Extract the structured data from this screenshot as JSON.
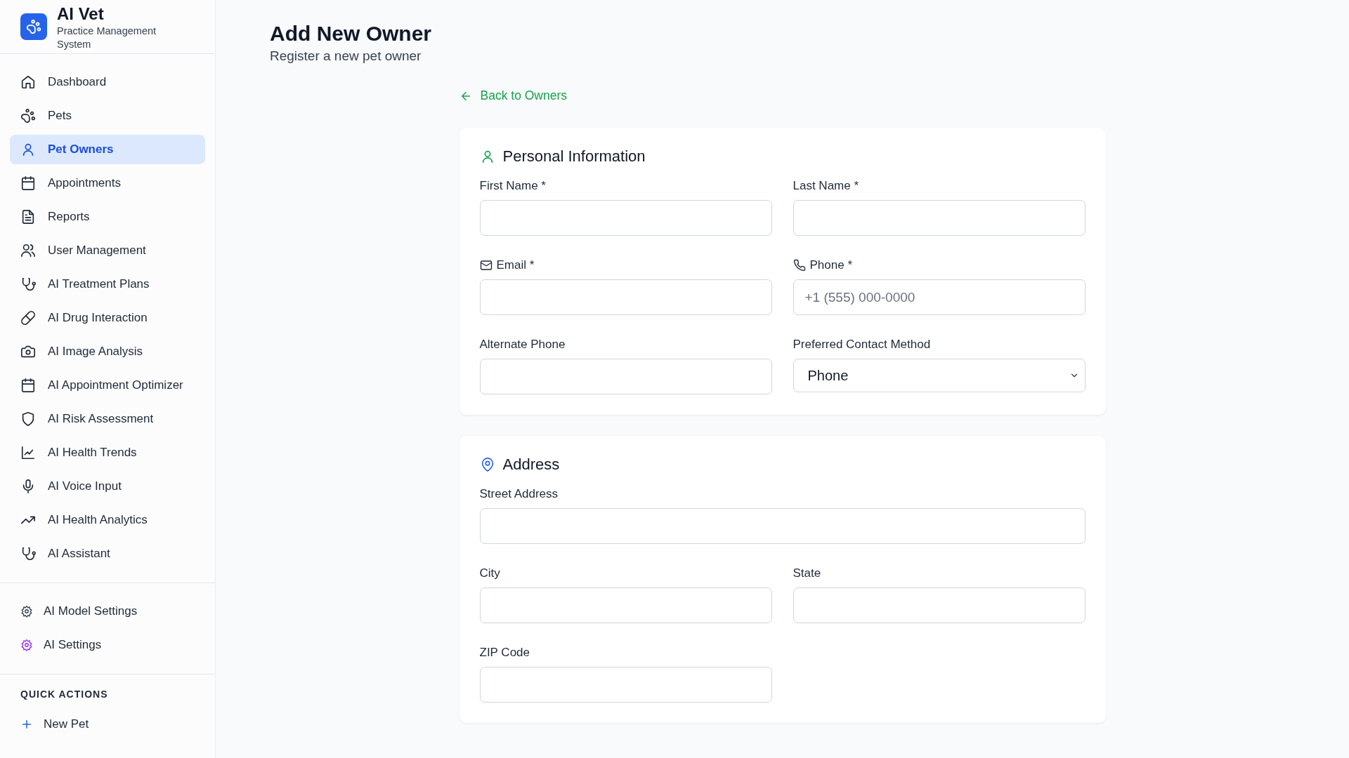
{
  "app": {
    "name": "AI Vet",
    "subtitle": "Practice Management System"
  },
  "nav": [
    {
      "label": "Dashboard",
      "selected": false
    },
    {
      "label": "Pets",
      "selected": false
    },
    {
      "label": "Pet Owners",
      "selected": true
    },
    {
      "label": "Appointments",
      "selected": false
    },
    {
      "label": "Reports",
      "selected": false
    },
    {
      "label": "User Management",
      "selected": false
    },
    {
      "label": "AI Treatment Plans",
      "selected": false
    },
    {
      "label": "AI Drug Interaction",
      "selected": false
    },
    {
      "label": "AI Image Analysis",
      "selected": false
    },
    {
      "label": "AI Appointment Optimizer",
      "selected": false
    },
    {
      "label": "AI Risk Assessment",
      "selected": false
    },
    {
      "label": "AI Health Trends",
      "selected": false
    },
    {
      "label": "AI Voice Input",
      "selected": false
    },
    {
      "label": "AI Health Analytics",
      "selected": false
    },
    {
      "label": "AI Assistant",
      "selected": false
    }
  ],
  "settings_nav": [
    {
      "label": "AI Model Settings",
      "selected": false
    },
    {
      "label": "AI Settings",
      "selected": false
    }
  ],
  "quick_actions": {
    "title": "QUICK ACTIONS",
    "items": [
      {
        "label": "New Pet"
      }
    ]
  },
  "page": {
    "title": "Add New Owner",
    "subtitle": "Register a new pet owner"
  },
  "back_link": "Back to Owners",
  "sections": [
    {
      "title": "Personal Information",
      "fields": [
        {
          "label": "First Name *",
          "kind": "input"
        },
        {
          "label": "Last Name *",
          "kind": "input"
        },
        {
          "label": "Email *",
          "kind": "input"
        },
        {
          "label": "Phone *",
          "kind": "input",
          "placeholder": "+1 (555) 000-0000"
        },
        {
          "label": "Alternate Phone",
          "kind": "input"
        },
        {
          "label": "Preferred Contact Method",
          "kind": "select",
          "value": "Phone"
        }
      ]
    },
    {
      "title": "Address",
      "fields": [
        {
          "label": "Street Address",
          "kind": "wide_input"
        },
        {
          "label": "City",
          "kind": "input"
        },
        {
          "label": "State",
          "kind": "input"
        },
        {
          "label": "ZIP Code",
          "kind": "input"
        }
      ]
    }
  ]
}
